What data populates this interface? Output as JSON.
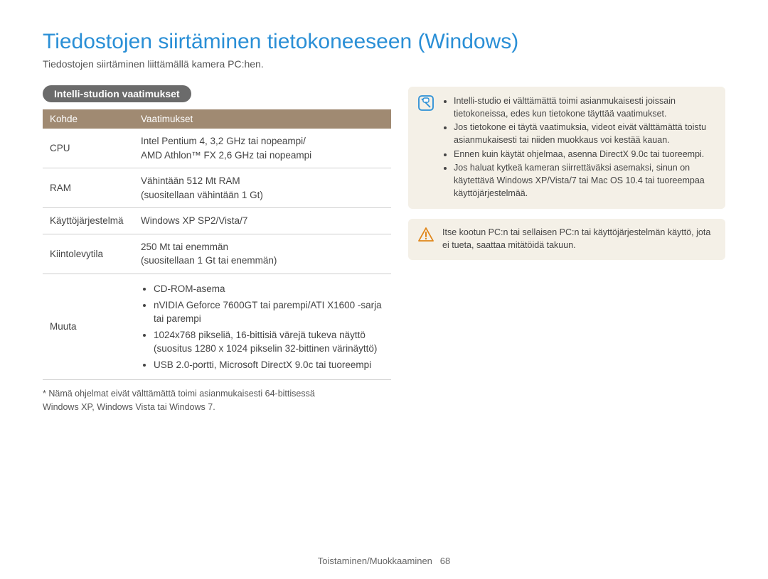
{
  "title": "Tiedostojen siirtäminen tietokoneeseen (Windows)",
  "intro": "Tiedostojen siirtäminen liittämällä kamera PC:hen.",
  "section_heading": "Intelli-studion vaatimukset",
  "table": {
    "headers": {
      "kohde": "Kohde",
      "vaatimukset": "Vaatimukset"
    },
    "rows": {
      "cpu": {
        "label": "CPU",
        "value": "Intel Pentium 4, 3,2 GHz tai nopeampi/\nAMD Athlon™ FX 2,6 GHz tai nopeampi"
      },
      "ram": {
        "label": "RAM",
        "value": "Vähintään 512 Mt RAM\n(suositellaan vähintään 1 Gt)"
      },
      "os": {
        "label": "Käyttöjärjestelmä",
        "value": "Windows XP SP2/Vista/7"
      },
      "hdd": {
        "label": "Kiintolevytila",
        "value": "250 Mt tai enemmän\n(suositellaan 1 Gt tai enemmän)"
      },
      "muuta": {
        "label": "Muuta",
        "items": [
          "CD-ROM-asema",
          "nVIDIA Geforce 7600GT tai parempi/ATI X1600 -sarja tai parempi",
          "1024x768 pikseliä, 16-bittisiä värejä tukeva näyttö (suositus 1280 x 1024 pikselin 32-bittinen värinäyttö)",
          "USB 2.0-portti, Microsoft DirectX 9.0c tai tuoreempi"
        ]
      }
    }
  },
  "footnote": "* Nämä ohjelmat eivät välttämättä toimi asianmukaisesti 64-bittisessä\n  Windows XP, Windows Vista tai Windows 7.",
  "info_note": {
    "items": [
      "Intelli-studio ei välttämättä toimi asianmukaisesti joissain tietokoneissa, edes kun tietokone täyttää vaatimukset.",
      "Jos tietokone ei täytä vaatimuksia, videot eivät välttämättä toistu asianmukaisesti tai niiden muokkaus voi kestää kauan.",
      "Ennen kuin käytät ohjelmaa, asenna DirectX 9.0c tai tuoreempi.",
      "Jos haluat kytkeä kameran siirrettäväksi asemaksi, sinun on käytettävä Windows XP/Vista/7 tai Mac OS 10.4 tai tuoreempaa käyttöjärjestelmää."
    ]
  },
  "warn_note": "Itse kootun PC:n tai sellaisen PC:n tai käyttöjärjestelmän käyttö, jota ei tueta, saattaa mitätöidä takuun.",
  "footer": {
    "section": "Toistaminen/Muokkaaminen",
    "page": "68"
  }
}
